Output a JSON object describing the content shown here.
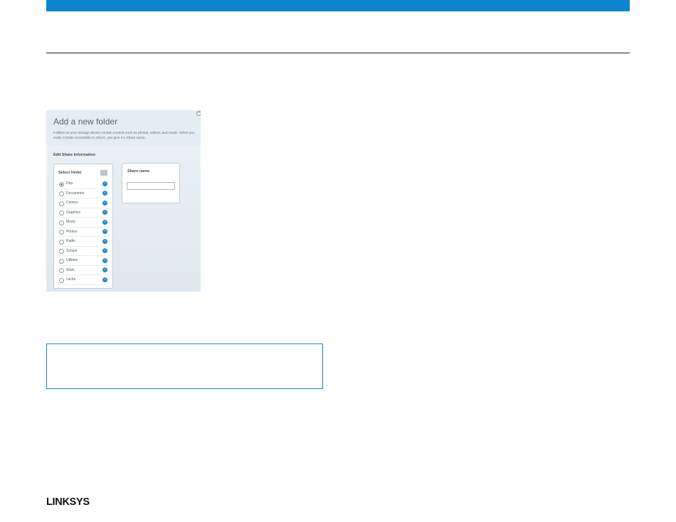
{
  "dialog": {
    "title": "Add a new folder",
    "description": "Folders on your storage device contain content such as photos, videos, and music. When you make a folder accessible to others, you give it a Share name.",
    "section_title": "Edit Share Information",
    "select_folder": {
      "title": "Select folder",
      "items": [
        {
          "label": "Drip",
          "selected": true
        },
        {
          "label": "Documents",
          "selected": false
        },
        {
          "label": "Comics",
          "selected": false
        },
        {
          "label": "Graphics",
          "selected": false
        },
        {
          "label": "Music",
          "selected": false
        },
        {
          "label": "Photos",
          "selected": false
        },
        {
          "label": "Radio",
          "selected": false
        },
        {
          "label": "School",
          "selected": false
        },
        {
          "label": "Utilities",
          "selected": false
        },
        {
          "label": "Work",
          "selected": false
        },
        {
          "label": "cache",
          "selected": false
        }
      ]
    },
    "share_name": {
      "title": "Share name",
      "value": ""
    }
  },
  "footer": {
    "logo_text": "LINKSYS"
  },
  "colors": {
    "accent": "#0e84cf",
    "note_border": "#1a84c8",
    "arrow_button": "#2a87c9"
  }
}
